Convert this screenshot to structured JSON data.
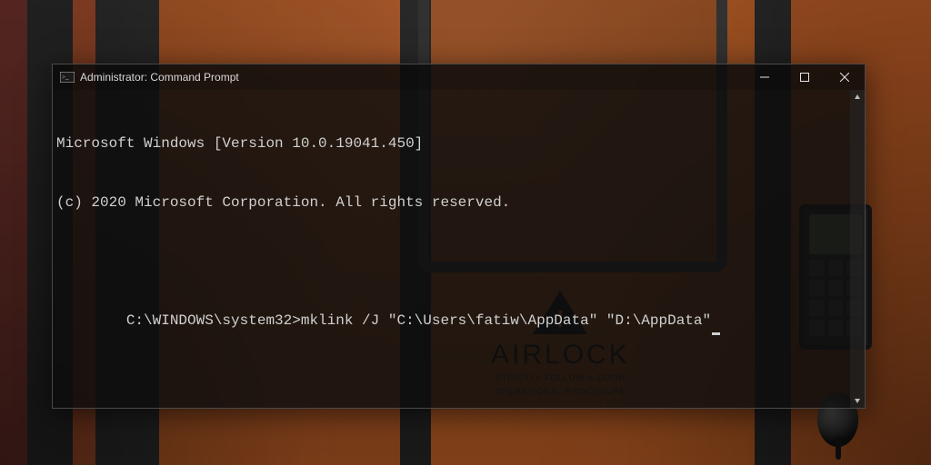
{
  "window": {
    "title": "Administrator: Command Prompt"
  },
  "terminal": {
    "banner_line1": "Microsoft Windows [Version 10.0.19041.450]",
    "banner_line2": "(c) 2020 Microsoft Corporation. All rights reserved.",
    "blank": "",
    "prompt": "C:\\WINDOWS\\system32>",
    "command": "mklink /J \"C:\\Users\\fatiw\\AppData\" \"D:\\AppData\""
  },
  "wallpaper": {
    "sign_title": "AIRLOCK",
    "sign_sub1": "STRICTLY FOLLOW A-DOOR",
    "sign_sub2": "OPERATIONAL PROCEDURE"
  }
}
